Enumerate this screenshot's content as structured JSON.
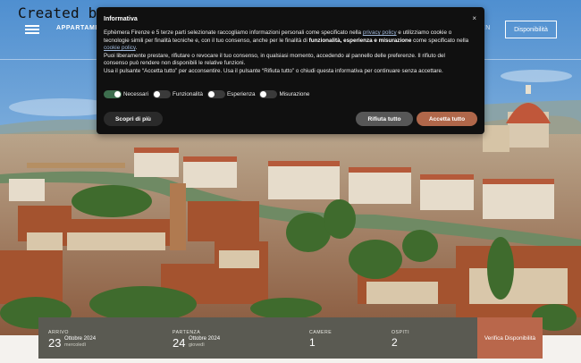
{
  "watermark": "Created by",
  "header": {
    "nav_left": "APPARTAMENTI",
    "nav_right": "EN",
    "availability_button": "Disponibilità"
  },
  "cookie_modal": {
    "title": "Informativa",
    "close_symbol": "×",
    "p1_a": "Ephèmera Firenze e 5 terze parti selezionate raccogliamo informazioni personali come specificato nella ",
    "p1_link1": "privacy policy",
    "p1_b": " e utilizziamo cookie o tecnologie simili per finalità tecniche e, con il tuo consenso, anche per le finalità di ",
    "p1_bold": "funzionalità, esperienza e misurazione",
    "p1_c": " come specificato nella ",
    "p1_link2": "cookie policy",
    "p1_d": ".",
    "p2": "Puoi liberamente prestare, rifiutare o revocare il tuo consenso, in qualsiasi momento, accedendo al pannello delle preferenze. Il rifiuto del consenso può rendere non disponibili le relative funzioni.",
    "p3": "Usa il pulsante “Accetta tutto” per acconsentire. Usa il pulsante “Rifiuta tutto” o chiudi questa informativa per continuare senza accettare.",
    "toggles": [
      {
        "label": "Necessari",
        "on": true
      },
      {
        "label": "Funzionalità",
        "on": false
      },
      {
        "label": "Esperienza",
        "on": false
      },
      {
        "label": "Misurazione",
        "on": false
      }
    ],
    "learn_more": "Scopri di più",
    "reject_all": "Rifiuta tutto",
    "accept_all": "Accetta tutto"
  },
  "booking": {
    "arrive_label": "ARRIVO",
    "arrive_day": "23",
    "arrive_month": "Ottobre 2024",
    "arrive_weekday": "mercoledì",
    "depart_label": "PARTENZA",
    "depart_day": "24",
    "depart_month": "Ottobre 2024",
    "depart_weekday": "giovedì",
    "rooms_label": "CAMERE",
    "rooms_value": "1",
    "guests_label": "OSPITI",
    "guests_value": "2",
    "check_button": "Verifica Disponibilità"
  },
  "colors": {
    "accent": "#b9674b",
    "modal_bg": "#101010",
    "booking_bg": "#5a5a52"
  }
}
